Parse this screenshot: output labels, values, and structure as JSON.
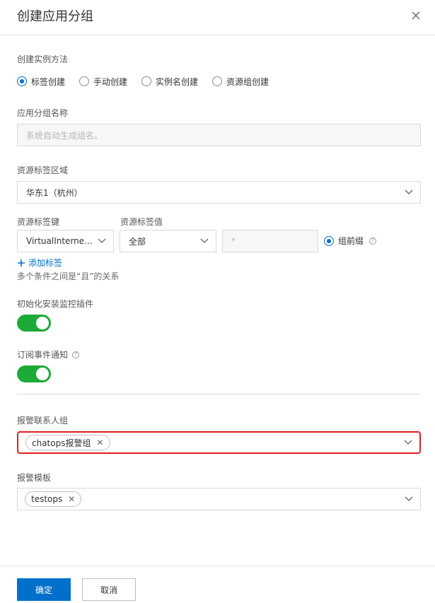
{
  "dialog": {
    "title": "创建应用分组",
    "close_icon": "close-icon"
  },
  "create_method": {
    "label": "创建实例方法",
    "options": [
      "标签创建",
      "手动创建",
      "实例名创建",
      "资源组创建"
    ],
    "selected": "标签创建"
  },
  "group_name": {
    "label": "应用分组名称",
    "placeholder": "系统自动生成组名。"
  },
  "region": {
    "label": "资源标签区域",
    "value": "华东1（杭州）"
  },
  "tag_key": {
    "label": "资源标签键",
    "value": "VirtualInterne..."
  },
  "tag_value": {
    "label": "资源标签值",
    "value": "全部",
    "text_placeholder": "*",
    "prefix_radio_label": "组前缀"
  },
  "add_tag": {
    "label": "添加标签",
    "hint": "多个条件之间是“且”的关系"
  },
  "install_plugin": {
    "label": "初始化安装监控插件",
    "enabled": true
  },
  "subscribe_event": {
    "label": "订阅事件通知",
    "enabled": true
  },
  "alert_contact": {
    "label": "报警联系人组",
    "tags": [
      "chatops报警组"
    ]
  },
  "alert_template": {
    "label": "报警模板",
    "tags": [
      "testops"
    ]
  },
  "footer": {
    "confirm": "确定",
    "cancel": "取消"
  },
  "colors": {
    "primary": "#0070cc",
    "toggle_on": "#1eaa39",
    "highlight_border": "#e02020"
  }
}
